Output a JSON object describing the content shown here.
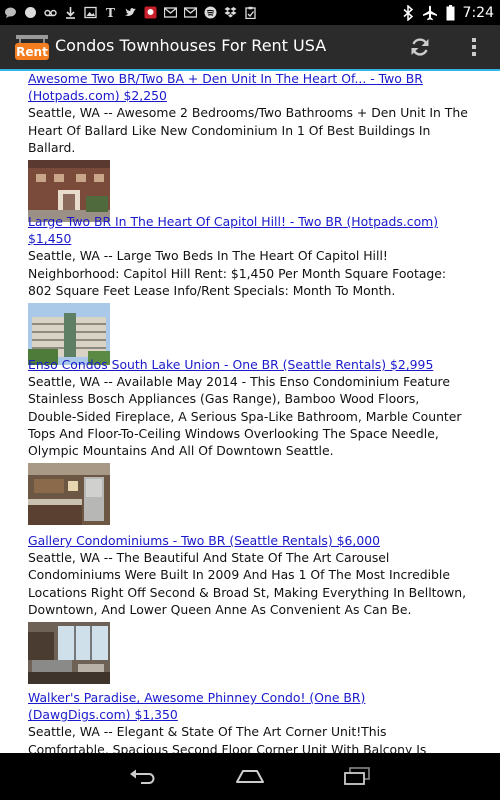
{
  "status": {
    "time": "7:24"
  },
  "app": {
    "title": "Condos Townhouses For Rent USA",
    "logo_text": "Rent"
  },
  "listings": [
    {
      "title": "Awesome Two BR/Two BA + Den Unit In The Heart Of... - Two BR (Hotpads.com) $2,250",
      "description": "Seattle, WA -- Awesome 2 Bedrooms/Two Bathrooms + Den Unit In The Heart Of Ballard Like New Condominium In 1 Of Best Buildings In Ballard."
    },
    {
      "title": "Large Two BR In The Heart Of Capitol Hill! - Two BR (Hotpads.com) $1,450",
      "description": "Seattle, WA -- Large Two Beds In The Heart Of Capitol Hill! Neighborhood: Capitol Hill Rent: $1,450 Per Month Square Footage: 802 Square Feet Lease Info/Rent Specials: Month To Month."
    },
    {
      "title": "Enso Condos South Lake Union - One BR (Seattle Rentals) $2,995",
      "description": "Seattle, WA -- Available May 2014 - This Enso Condominium Feature Stainless Bosch Appliances (Gas Range), Bamboo Wood Floors, Double-Sided Fireplace, A Serious Spa-Like Bathroom, Marble Counter Tops And Floor-To-Ceiling Windows Overlooking The Space Needle, Olympic Mountains And All Of Downtown Seattle."
    },
    {
      "title": "Gallery Condominiums - Two BR (Seattle Rentals) $6,000",
      "description": "Seattle, WA -- The Beautiful And State Of The Art Carousel Condominiums Were Built In 2009 And Has 1 Of The Most Incredible Locations Right Off Second & Broad St, Making Everything In Belltown, Downtown, And Lower Queen Anne As Convenient As Can Be."
    },
    {
      "title": "Walker's Paradise, Awesome Phinney Condo! (One BR) (DawgDigs.com) $1,350",
      "description": "Seattle, WA -- Elegant & State Of The Art Corner Unit!This Comfortable, Spacious Second Floor Corner Unit With Balcony Is Situated Perfectly In"
    }
  ],
  "icons": {
    "status_left": [
      "chat-icon",
      "circle-icon",
      "voicemail-icon",
      "download-icon",
      "image-icon",
      "nyt-icon",
      "twitter-icon",
      "app-icon",
      "gmail-icon",
      "gmail-icon",
      "spotify-icon",
      "dropbox-icon",
      "clipboard-icon"
    ],
    "status_right": [
      "bluetooth-icon",
      "airplane-icon",
      "battery-icon"
    ],
    "toolbar": [
      "refresh-icon",
      "overflow-menu-icon"
    ],
    "nav": [
      "back-icon",
      "home-icon",
      "recent-apps-icon"
    ]
  },
  "colors": {
    "link": "#1a1acc",
    "accent": "#33b5e5",
    "logo": "#f47d20",
    "app_bar": "#2b2b2b"
  }
}
